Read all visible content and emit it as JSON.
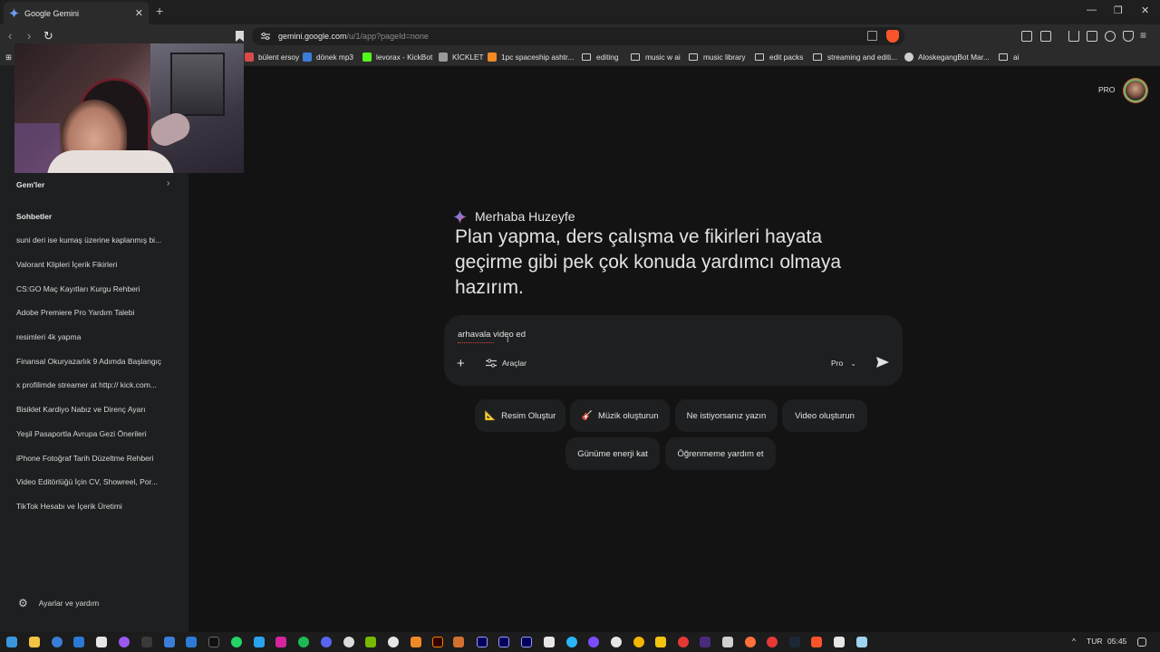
{
  "browser": {
    "tab_title": "Google Gemini",
    "tab_close": "✕",
    "new_tab": "+",
    "url_host": "gemini.google.com",
    "url_path": "/u/1/app?pageId=none",
    "window_controls": [
      "—",
      "❐",
      "✕"
    ]
  },
  "bookmarks": [
    {
      "label": "bülent ersoy",
      "icon": "favicon",
      "color": "#d94a4a"
    },
    {
      "label": "dönek mp3",
      "icon": "favicon",
      "color": "#3b7dd8"
    },
    {
      "label": "levorax - KickBot",
      "icon": "favicon",
      "color": "#53fc18"
    },
    {
      "label": "KİCKLET",
      "icon": "favicon",
      "color": "#9a9a9a"
    },
    {
      "label": "1pc spaceship ashtr...",
      "icon": "favicon",
      "color": "#f08a24"
    },
    {
      "label": "editing",
      "icon": "folder"
    },
    {
      "label": "music w ai",
      "icon": "folder"
    },
    {
      "label": "music library",
      "icon": "folder"
    },
    {
      "label": "edit packs",
      "icon": "folder"
    },
    {
      "label": "streaming and editi...",
      "icon": "folder"
    },
    {
      "label": "AloskegangBot Mar...",
      "icon": "favicon",
      "color": "#cfcfcf"
    },
    {
      "label": "ai",
      "icon": "folder"
    }
  ],
  "sidebar": {
    "gems_label": "Gem'ler",
    "chats_label": "Sohbetler",
    "chats": [
      "suni deri ise kumaş üzerine kaplanmış bi...",
      "Valorant Klipleri İçerik Fikirleri",
      "CS:GO Maç Kayıtları Kurgu Rehberi",
      "Adobe Premiere Pro Yardım Talebi",
      "resimleri 4k yapma",
      "Finansal Okuryazarlık 9 Adımda Başlangıç",
      "x profilimde streamer at http:// kick.com...",
      "Bisiklet Kardiyo Nabız ve Direnç Ayarı",
      "Yeşil Pasaportla Avrupa Gezi Önerileri",
      "iPhone Fotoğraf Tarih Düzeltme Rehberi",
      "Video Editörlüğü İçin CV, Showreel, Por...",
      "TikTok Hesabı ve İçerik Üretimi"
    ],
    "settings_label": "Ayarlar ve yardım"
  },
  "header": {
    "plan_badge": "PRO"
  },
  "main": {
    "greeting": "Merhaba Huzeyfe",
    "headline": "Plan yapma, ders çalışma ve fikirleri hayata geçirme gibi pek çok konuda yardımcı olmaya hazırım.",
    "prompt_value": "arhavala video ed",
    "add_label": "+",
    "tools_label": "Araçlar",
    "model_label": "Pro",
    "chips": [
      {
        "emoji": "📐",
        "label": "Resim Oluştur"
      },
      {
        "emoji": "🎸",
        "label": "Müzik oluşturun"
      },
      {
        "emoji": "",
        "label": "Ne istiyorsanız yazın"
      },
      {
        "emoji": "",
        "label": "Video oluşturun"
      },
      {
        "emoji": "",
        "label": "Günüme enerji kat"
      },
      {
        "emoji": "",
        "label": "Öğrenmeme yardım et"
      }
    ]
  },
  "taskbar": {
    "language": "TUR",
    "time": "05:45",
    "tray_arrow": "^"
  },
  "colors": {
    "accent_blue": "#4285f4",
    "gemini_purple": "#9b72cb",
    "brave_orange": "#fb542b"
  }
}
